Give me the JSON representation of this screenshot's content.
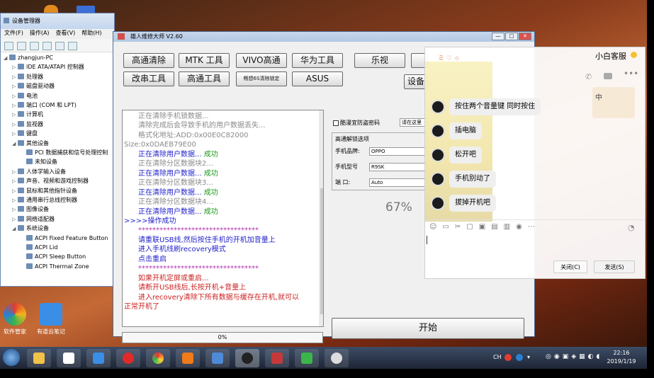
{
  "device_manager": {
    "title": "设备管理器",
    "menu": [
      "文件(F)",
      "操作(A)",
      "查看(V)",
      "帮助(H)"
    ],
    "tree": [
      {
        "label": "zhangjun-PC",
        "level": 0,
        "expanded": true
      },
      {
        "label": "IDE ATA/ATAPI 控制器",
        "level": 1
      },
      {
        "label": "处理器",
        "level": 1
      },
      {
        "label": "磁盘驱动器",
        "level": 1
      },
      {
        "label": "电池",
        "level": 1
      },
      {
        "label": "端口 (COM 和 LPT)",
        "level": 1
      },
      {
        "label": "计算机",
        "level": 1
      },
      {
        "label": "监视器",
        "level": 1
      },
      {
        "label": "键盘",
        "level": 1
      },
      {
        "label": "其他设备",
        "level": 1,
        "expanded": true
      },
      {
        "label": "PCI 数据捕获和信号处理控制",
        "level": 2
      },
      {
        "label": "未知设备",
        "level": 2
      },
      {
        "label": "人体学输入设备",
        "level": 1
      },
      {
        "label": "声音、视频和游戏控制器",
        "level": 1
      },
      {
        "label": "鼠标和其他指针设备",
        "level": 1
      },
      {
        "label": "通用串行总线控制器",
        "level": 1
      },
      {
        "label": "图像设备",
        "level": 1
      },
      {
        "label": "网络适配器",
        "level": 1
      },
      {
        "label": "系统设备",
        "level": 1,
        "expanded": true
      },
      {
        "label": "ACPI Fixed Feature Button",
        "level": 2
      },
      {
        "label": "ACPI Lid",
        "level": 2
      },
      {
        "label": "ACPI Sleep Button",
        "level": 2
      },
      {
        "label": "ACPI Thermal Zone",
        "level": 2
      }
    ]
  },
  "tool": {
    "title": "雄人维修大师 V2.60",
    "window_buttons": [
      "—",
      "□",
      "✕"
    ],
    "buttons_row1": [
      "高通清除",
      "MTK 工具",
      "VIVO高通",
      "华为工具",
      "乐视",
      ""
    ],
    "buttons_row2": [
      "改串工具",
      "高通工具",
      "畅想6S清除锁定",
      "ASUS",
      "设备"
    ],
    "log": [
      {
        "text": "正在清除手机锁数据...",
        "color": "#8a8a8a",
        "indent": 1
      },
      {
        "text": "清除完成后会导致手机的用户数据丢失...",
        "color": "#8a8a8a",
        "indent": 1
      },
      {
        "text": "格式化地址:ADD:0x00E0C82000",
        "color": "#8a8a8a",
        "indent": 1
      },
      {
        "text": "Size:0x0DAEB79E00",
        "color": "#8a8a8a",
        "indent": 0
      },
      {
        "text": "正在清除用户数据... ",
        "color": "#2222cc",
        "indent": 1,
        "suffix": "成功",
        "suffix_color": "#1a9a1a"
      },
      {
        "text": "正在清除分区数据块2...",
        "color": "#8a8a8a",
        "indent": 1
      },
      {
        "text": "正在清除用户数据... ",
        "color": "#2222cc",
        "indent": 1,
        "suffix": "成功",
        "suffix_color": "#1a9a1a"
      },
      {
        "text": "正在清除分区数据块3...",
        "color": "#8a8a8a",
        "indent": 1
      },
      {
        "text": "正在清除用户数据... ",
        "color": "#2222cc",
        "indent": 1,
        "suffix": "成功",
        "suffix_color": "#1a9a1a"
      },
      {
        "text": "正在清除分区数据块4...",
        "color": "#8a8a8a",
        "indent": 1
      },
      {
        "text": "正在清除用户数据... ",
        "color": "#2222cc",
        "indent": 1,
        "suffix": "成功",
        "suffix_color": "#1a9a1a"
      },
      {
        "text": ">>>>操作成功",
        "color": "#2222cc",
        "indent": 0
      },
      {
        "text": "**********************************",
        "color": "#b030b0",
        "indent": 1
      },
      {
        "text": "请重联USB线,然后按住手机的开机加音量上",
        "color": "#2222cc",
        "indent": 1
      },
      {
        "text": "进入手机线刷recovery模式",
        "color": "#2222cc",
        "indent": 1
      },
      {
        "text": "点击重启",
        "color": "#2222cc",
        "indent": 1
      },
      {
        "text": "**********************************",
        "color": "#b030b0",
        "indent": 1
      },
      {
        "text": "如果开机定屏或重启...",
        "color": "#cc2222",
        "indent": 1
      },
      {
        "text": "请断开USB线后,长按开机+音量上",
        "color": "#cc2222",
        "indent": 1
      },
      {
        "text": "进入recovery清除下所有数据与缓存在开机,就可以",
        "color": "#cc2222",
        "indent": 1
      },
      {
        "text": "正常开机了",
        "color": "#cc2222",
        "indent": 0
      }
    ],
    "progress_text": "0%",
    "checkbox_label": "酷漫宜防盗密码",
    "select_value": "请在这里",
    "group_title": "高通解锁选项",
    "brand_label": "手机品牌:",
    "brand_value": "OPPO",
    "model_label": "手机型号",
    "model_value": "R9SK",
    "port_label": "端    口:",
    "port_value": "Auto",
    "percent": "67%",
    "start_label": "开始"
  },
  "chat": {
    "title": "小白客服",
    "messages": [
      "按住两个音量键 同时按住",
      "插电脑",
      "松开吧",
      "手机别动了",
      "拔掉开机吧"
    ],
    "close_label": "关闭(C)",
    "send_label": "发送(S)",
    "sticker_text": "中"
  },
  "desktop_icons": [
    "软件管家",
    "有道云笔记"
  ],
  "taskbar": {
    "time": "22:16",
    "date": "2019/1/19",
    "tray_text": "CH"
  }
}
